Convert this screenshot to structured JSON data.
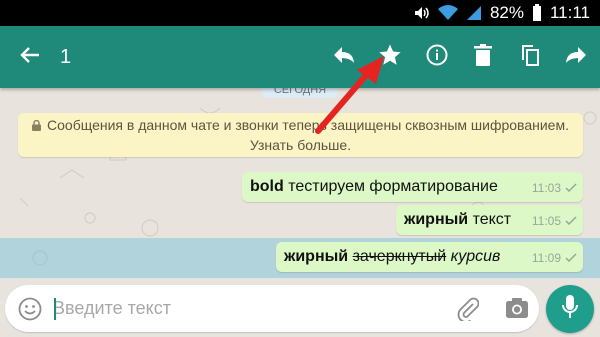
{
  "status_bar": {
    "battery_percent": "82%",
    "time": "11:11"
  },
  "toolbar": {
    "selected_count": "1",
    "icons": [
      "back-arrow-icon",
      "reply-icon",
      "star-icon",
      "info-icon",
      "delete-icon",
      "copy-icon",
      "forward-icon"
    ]
  },
  "chat": {
    "date_chip": "СЕГОДНЯ",
    "encryption_notice_line1": "Сообщения в данном чате и звонки теперь защищены сквозным шифрованием.",
    "encryption_notice_line2": "Узнать больше.",
    "messages": [
      {
        "bold": "bold",
        "text": " тестируем форматирование",
        "time": "11:03"
      },
      {
        "bold": "жирный",
        "text": " текст",
        "time": "11:05"
      },
      {
        "bold": "жирный",
        "strike": "зачеркнутый",
        "italic": "курсив",
        "time": "11:09",
        "selected": true
      }
    ]
  },
  "composer": {
    "placeholder": "Введите текст"
  },
  "colors": {
    "toolbar": "#1f8a7a",
    "outgoing_bubble": "#dcf8c6",
    "notice": "#fbf4c4",
    "selection": "#9fd3e6",
    "annotation_arrow": "#e52421"
  }
}
